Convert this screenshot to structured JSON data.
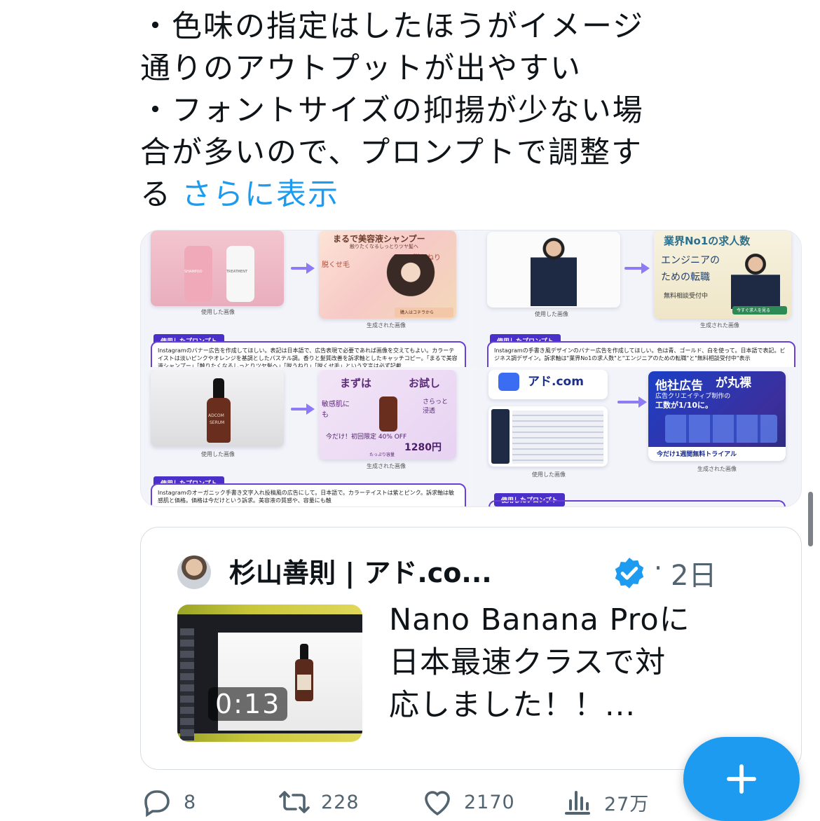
{
  "tweet": {
    "lines": [
      "・色味の指定はしたほうがイメージ",
      "通りのアウトプットが出やすい",
      "・フォントサイズの抑揚が少ない場",
      "合が多いので、プロンプトで調整す"
    ],
    "last_line": "る",
    "show_more": "さらに表示"
  },
  "media": {
    "used_image": "使用した画像",
    "generated_image": "生成された画像",
    "prompt_label": "使用したプロンプト",
    "panel1": {
      "bottle1": "SHAMPOO",
      "bottle2": "TREATMENT",
      "headline": "まるで美容液シャンプー",
      "sub": "触りたくなるしっとりツヤ髪へ",
      "tag_a": "脱うねり",
      "tag_b": "脱くせ毛",
      "cta": "購入はコチラから",
      "prompt": "Instagramのバナー広告を作成してほしい。表記は日本語で、広告表現で必要であれば画像を交えてもよい。カラーテイストは淡いピンクやオレンジを基調としたパステル調。香りと髪質改善を訴求軸としたキャッチコピー。「まるで美容液シャンプー」「触りたくなるしっとりツヤ髪へ」「脱うねり」「脱くせ毛」という文言は必ず記載"
    },
    "panel2": {
      "headline": "業界No1の求人数",
      "line1": "エンジニアの",
      "line2": "ための転職",
      "free": "無料相談受付中",
      "cta": "今すぐ求人を見る",
      "prompt": "Instagramの手書き風デザインのバナー広告を作成してほしい。色は青、ゴールド、白を使って。日本語で表記。ビジネス調デザイン。訴求軸は\"業界No1の求人数\"と\"エンジニアのための転職\"と\"無料相談受付中\"表示"
    },
    "panel3": {
      "brand": "ADCOM",
      "product": "SERUM",
      "headline_a": "まずは",
      "headline_b": "お試し",
      "tag_a": "敏感肌にも",
      "tag_b": "さらっと浸透",
      "offer": "今だけ！初回限定 40% OFF",
      "price": "1280円",
      "note": "たっぷり容量",
      "prompt": "Instagramのオーガニック手書き文字入れ投稿風の広告にして。日本語で。カラーテイストは紫とピンク。訴求軸は敏感肌と価格。価格は今だけという訴求。美容液の質感や、容量にも触"
    },
    "panel4": {
      "logo": "アド.com",
      "headline_a": "他社広告",
      "headline_b": "が丸裸",
      "sub": "広告クリエイティブ制作の",
      "sub2": "工数が1/10に。",
      "cta": "今だけ1週間無料トライアル"
    }
  },
  "quote": {
    "author": "杉山善則 | アド.co...",
    "separator": "·",
    "time": "2日",
    "duration": "0:13",
    "lines": [
      "Nano Banana Proに",
      "日本最速クラスで対",
      "応しました！！..."
    ]
  },
  "actions": {
    "replies": "8",
    "reposts": "228",
    "likes": "2170",
    "views": "27万"
  },
  "colors": {
    "accent": "#1d9bf0",
    "prompt_purple": "#4b2fc9",
    "text": "#0f1419",
    "muted": "#536471"
  }
}
